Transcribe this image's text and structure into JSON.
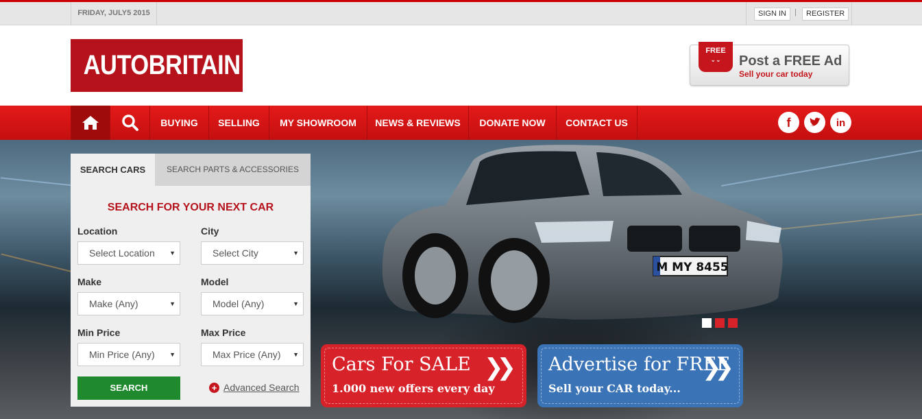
{
  "topbar": {
    "date": "FRIDAY, JULY5 2015",
    "sign_in": "SIGN IN",
    "separator": "|",
    "register": "REGISTER"
  },
  "header": {
    "logo": "AUTOBRITAIN",
    "post_ad": {
      "badge": "FREE",
      "title": "Post a FREE Ad",
      "subtitle": "Sell your car today"
    }
  },
  "nav": {
    "items": [
      {
        "label": "BUYING"
      },
      {
        "label": "SELLING"
      },
      {
        "label": "MY SHOWROOM"
      },
      {
        "label": "NEWS & REVIEWS"
      },
      {
        "label": "DONATE NOW"
      },
      {
        "label": "CONTACT US"
      }
    ],
    "social": [
      "facebook-icon",
      "twitter-icon",
      "linkedin-icon"
    ]
  },
  "search": {
    "tabs": [
      "SEARCH CARS",
      "SEARCH PARTS & ACCESSORIES"
    ],
    "active_tab": "SEARCH CARS",
    "title": "SEARCH FOR YOUR NEXT CAR",
    "fields": {
      "location": {
        "label": "Location",
        "value": "Select Location"
      },
      "city": {
        "label": "City",
        "value": "Select City"
      },
      "make": {
        "label": "Make",
        "value": "Make (Any)"
      },
      "model": {
        "label": "Model",
        "value": "Model (Any)"
      },
      "min_price": {
        "label": "Min Price",
        "value": "Min Price (Any)"
      },
      "max_price": {
        "label": "Max Price",
        "value": "Max Price (Any)"
      }
    },
    "button": "SEARCH",
    "advanced": "Advanced Search"
  },
  "promos": {
    "sale": {
      "title": "Cars For SALE",
      "subtitle": "1.000 new offers every day",
      "color": "#d8222a"
    },
    "advertise": {
      "title": "Advertise for FREE",
      "subtitle": "Sell your CAR today...",
      "color": "#3a73b6"
    }
  },
  "hero": {
    "plate": "M MY 8455",
    "slider_dots": 3,
    "active_dot": 1
  },
  "colors": {
    "brand_red": "#b5121b",
    "nav_red": "#e41a1a",
    "search_green": "#1f8a2d"
  }
}
